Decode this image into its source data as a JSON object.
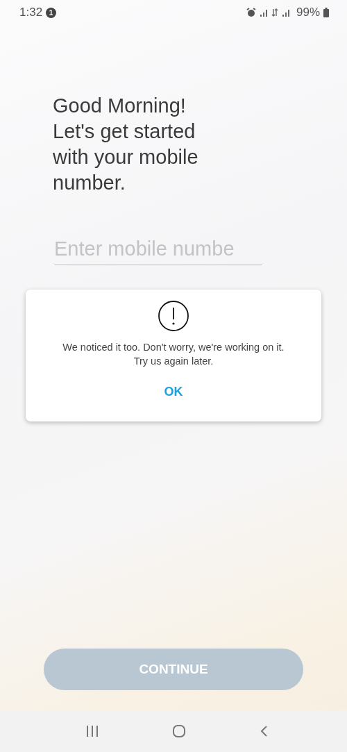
{
  "status_bar": {
    "time": "1:32",
    "notification_count": "1",
    "battery": "99%"
  },
  "heading": {
    "greeting": "Good Morning!",
    "prompt": "Let's get started with your mobile number."
  },
  "mobile_field": {
    "placeholder": "Enter mobile numbe"
  },
  "dialog": {
    "message": "We noticed it too. Don't worry, we're working on it. Try us again later.",
    "button": "OK"
  },
  "continue_button": {
    "label": "CONTINUE",
    "disabled": true
  }
}
